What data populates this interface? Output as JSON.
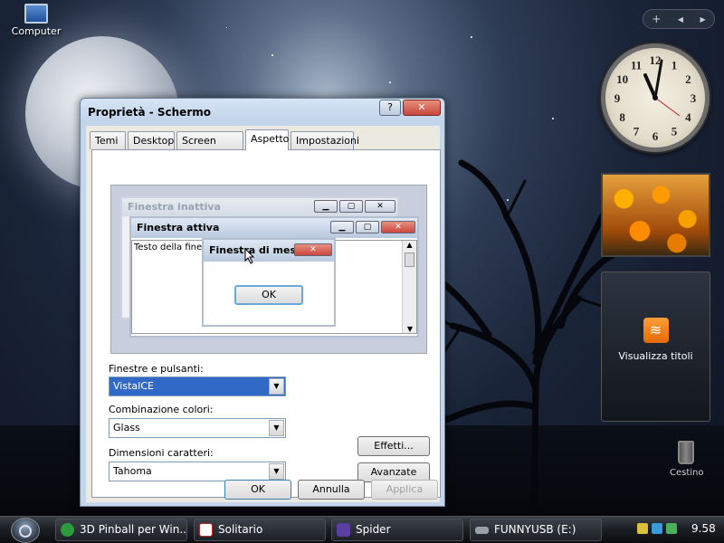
{
  "desktop": {
    "computer_icon_label": "Computer",
    "trash_label": "Cestino"
  },
  "sidebar": {
    "add_button": "+",
    "prev_button": "◀",
    "next_button": "▶",
    "clock_numbers": [
      "12",
      "1",
      "2",
      "3",
      "4",
      "5",
      "6",
      "7",
      "8",
      "9",
      "10",
      "11"
    ],
    "clock_time": "9.58",
    "rss_title": "Visualizza titoli"
  },
  "window": {
    "title": "Proprietà - Schermo",
    "help_button": "?",
    "close_button": "✕",
    "tabs": [
      {
        "label": "Temi"
      },
      {
        "label": "Desktop"
      },
      {
        "label": "Screen saver"
      },
      {
        "label": "Aspetto"
      },
      {
        "label": "Impostazioni"
      }
    ],
    "active_tab": "Aspetto",
    "preview": {
      "inactive_title": "Finestra inattiva",
      "active_title": "Finestra attiva",
      "window_text": "Testo della finestra",
      "message_title": "Finestra di mes...",
      "ok_label": "OK"
    },
    "windows_buttons_label": "Finestre e pulsanti:",
    "windows_buttons_value": "VistaICE",
    "color_scheme_label": "Combinazione colori:",
    "color_scheme_value": "Glass",
    "font_size_label": "Dimensioni caratteri:",
    "font_size_value": "Tahoma",
    "effects_button": "Effetti...",
    "advanced_button": "Avanzate",
    "ok_button": "OK",
    "cancel_button": "Annulla",
    "apply_button": "Applica"
  },
  "taskbar": {
    "items": [
      {
        "label": "3D Pinball per Win...",
        "color": "#2a9d3a"
      },
      {
        "label": "Solitario",
        "color": "#c62828"
      },
      {
        "label": "Spider",
        "color": "#5a3fa0"
      },
      {
        "label": "FUNNYUSB (E:)",
        "color": "#9aa0a8"
      }
    ],
    "time": "9.58"
  },
  "colors": {
    "selection": "#3169c6",
    "close_red": "#c9463d"
  }
}
